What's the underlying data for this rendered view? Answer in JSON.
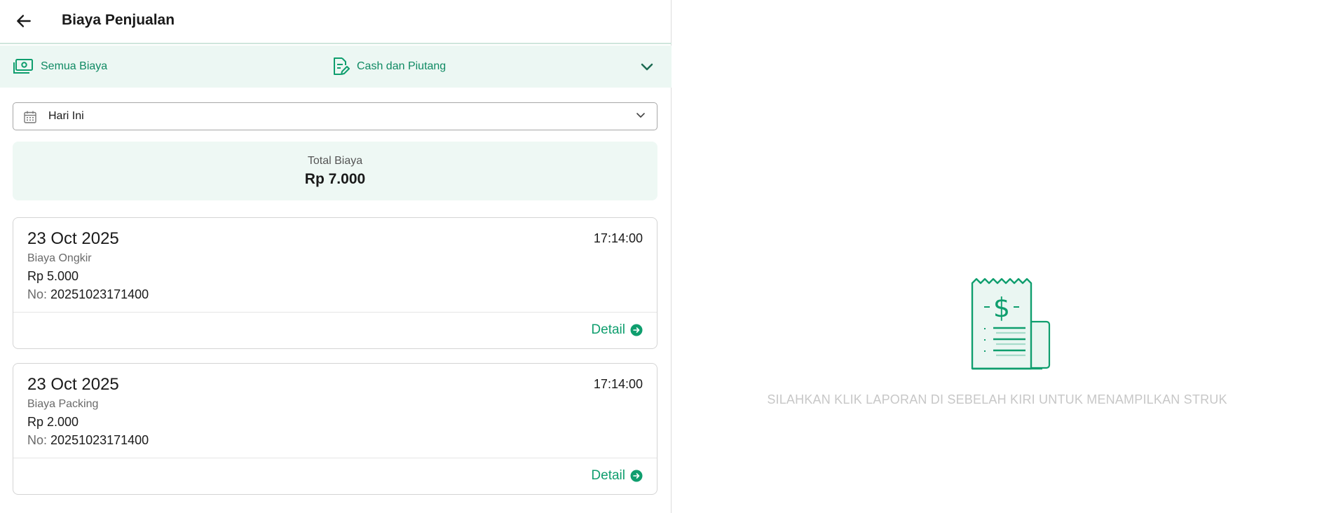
{
  "header": {
    "title": "Biaya Penjualan",
    "back_icon": "arrow-left-icon"
  },
  "filters": {
    "category": {
      "label": "Semua Biaya",
      "icon": "cash-icon"
    },
    "payment": {
      "label": "Cash dan Piutang",
      "icon": "document-edit-icon"
    },
    "expand_icon": "chevron-down-icon"
  },
  "date_filter": {
    "value": "Hari Ini",
    "icon": "calendar-icon"
  },
  "total": {
    "label": "Total Biaya",
    "value": "Rp 7.000"
  },
  "transactions": [
    {
      "date": "23 Oct 2025",
      "time": "17:14:00",
      "type": "Biaya Ongkir",
      "amount": "Rp 5.000",
      "no_label": "No:",
      "no": "20251023171400",
      "detail_label": "Detail"
    },
    {
      "date": "23 Oct 2025",
      "time": "17:14:00",
      "type": "Biaya Packing",
      "amount": "Rp 2.000",
      "no_label": "No:",
      "no": "20251023171400",
      "detail_label": "Detail"
    }
  ],
  "empty_state": {
    "message": "SILAHKAN KLIK LAPORAN DI SEBELAH KIRI UNTUK MENAMPILKAN STRUK",
    "icon": "receipt-icon"
  },
  "colors": {
    "accent": "#0f9e6e",
    "accent_light_bg": "#ecf7f3",
    "muted_text": "#c7c7c7"
  }
}
